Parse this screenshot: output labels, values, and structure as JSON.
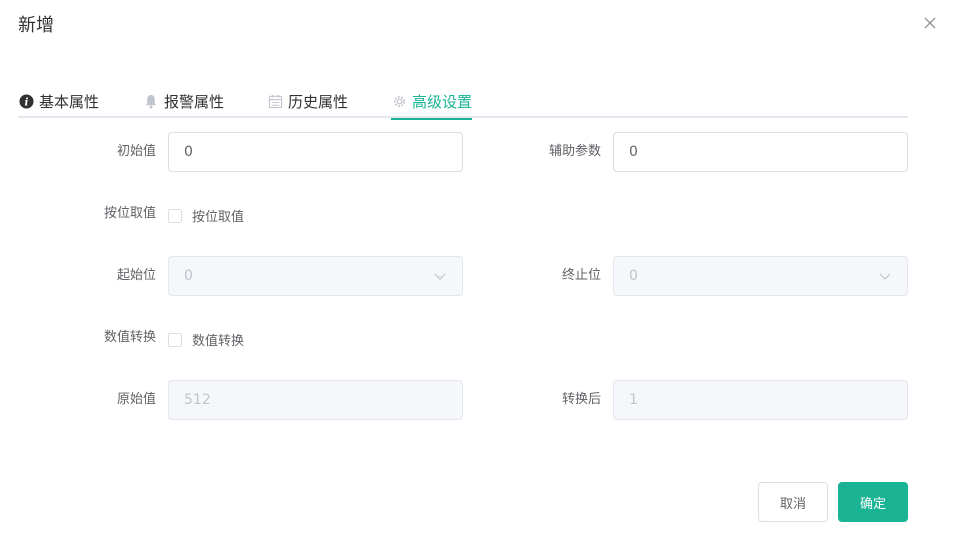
{
  "dialog": {
    "title": "新增",
    "close_icon": "close-icon"
  },
  "tabs": [
    {
      "label": "基本属性",
      "icon": "info-icon",
      "active": false
    },
    {
      "label": "报警属性",
      "icon": "bell-icon",
      "active": false
    },
    {
      "label": "历史属性",
      "icon": "calendar-icon",
      "active": false
    },
    {
      "label": "高级设置",
      "icon": "gear-icon",
      "active": true
    }
  ],
  "form": {
    "initial_value": {
      "label": "初始值",
      "value": "0"
    },
    "aux_param": {
      "label": "辅助参数",
      "value": "0"
    },
    "bit_read": {
      "label": "按位取值",
      "checkbox_label": "按位取值",
      "checked": false
    },
    "start_bit": {
      "label": "起始位",
      "value": "0",
      "disabled": true
    },
    "end_bit": {
      "label": "终止位",
      "value": "0",
      "disabled": true
    },
    "value_convert": {
      "label": "数值转换",
      "checkbox_label": "数值转换",
      "checked": false
    },
    "raw_value": {
      "label": "原始值",
      "value": "512",
      "disabled": true
    },
    "converted_value": {
      "label": "转换后",
      "value": "1",
      "disabled": true
    }
  },
  "footer": {
    "cancel_label": "取消",
    "ok_label": "确定"
  },
  "colors": {
    "accent": "#1ab394",
    "border": "#dcdfe6",
    "disabled_bg": "#f5f7fa"
  }
}
